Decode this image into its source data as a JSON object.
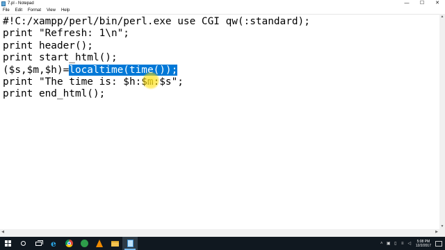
{
  "window": {
    "title": "7.pl - Notepad",
    "buttons": [
      "—",
      "☐",
      "✕"
    ]
  },
  "menu": [
    "File",
    "Edit",
    "Format",
    "View",
    "Help"
  ],
  "editor": {
    "lines": [
      "#!C:/xampp/perl/bin/perl.exe use CGI qw(:standard);",
      "print \"Refresh: 1\\n\";",
      "print header();",
      "print start_html();",
      {
        "before": "($s,$m,$h)=",
        "selected": "localtime(time());",
        "after": ""
      },
      "print \"The time is: $h:$m:$s\";",
      "print end_html();"
    ],
    "selection_color": "#0078d7"
  },
  "scrollbars": {
    "up_arrow": "▲",
    "down_arrow": "▼",
    "left_arrow": "◀",
    "right_arrow": "▶"
  },
  "taskbar": {
    "apps": [
      {
        "name": "start",
        "icon": "windows-icon"
      },
      {
        "name": "search",
        "icon": "search-icon"
      },
      {
        "name": "task-view",
        "icon": "task-view-icon"
      },
      {
        "name": "internet-explorer",
        "icon": "ie-icon",
        "glyph": "e"
      },
      {
        "name": "chrome",
        "icon": "chrome-icon"
      },
      {
        "name": "green-app",
        "icon": "green-app-icon"
      },
      {
        "name": "vlc",
        "icon": "vlc-icon"
      },
      {
        "name": "file-explorer",
        "icon": "folder-icon"
      },
      {
        "name": "notepad",
        "icon": "notepad-icon",
        "active": true
      }
    ],
    "tray_icons": [
      "˄",
      "▣",
      "▯",
      "≡",
      "◁"
    ],
    "clock": {
      "time": "5:08 PM",
      "date": "12/2/2017"
    }
  }
}
